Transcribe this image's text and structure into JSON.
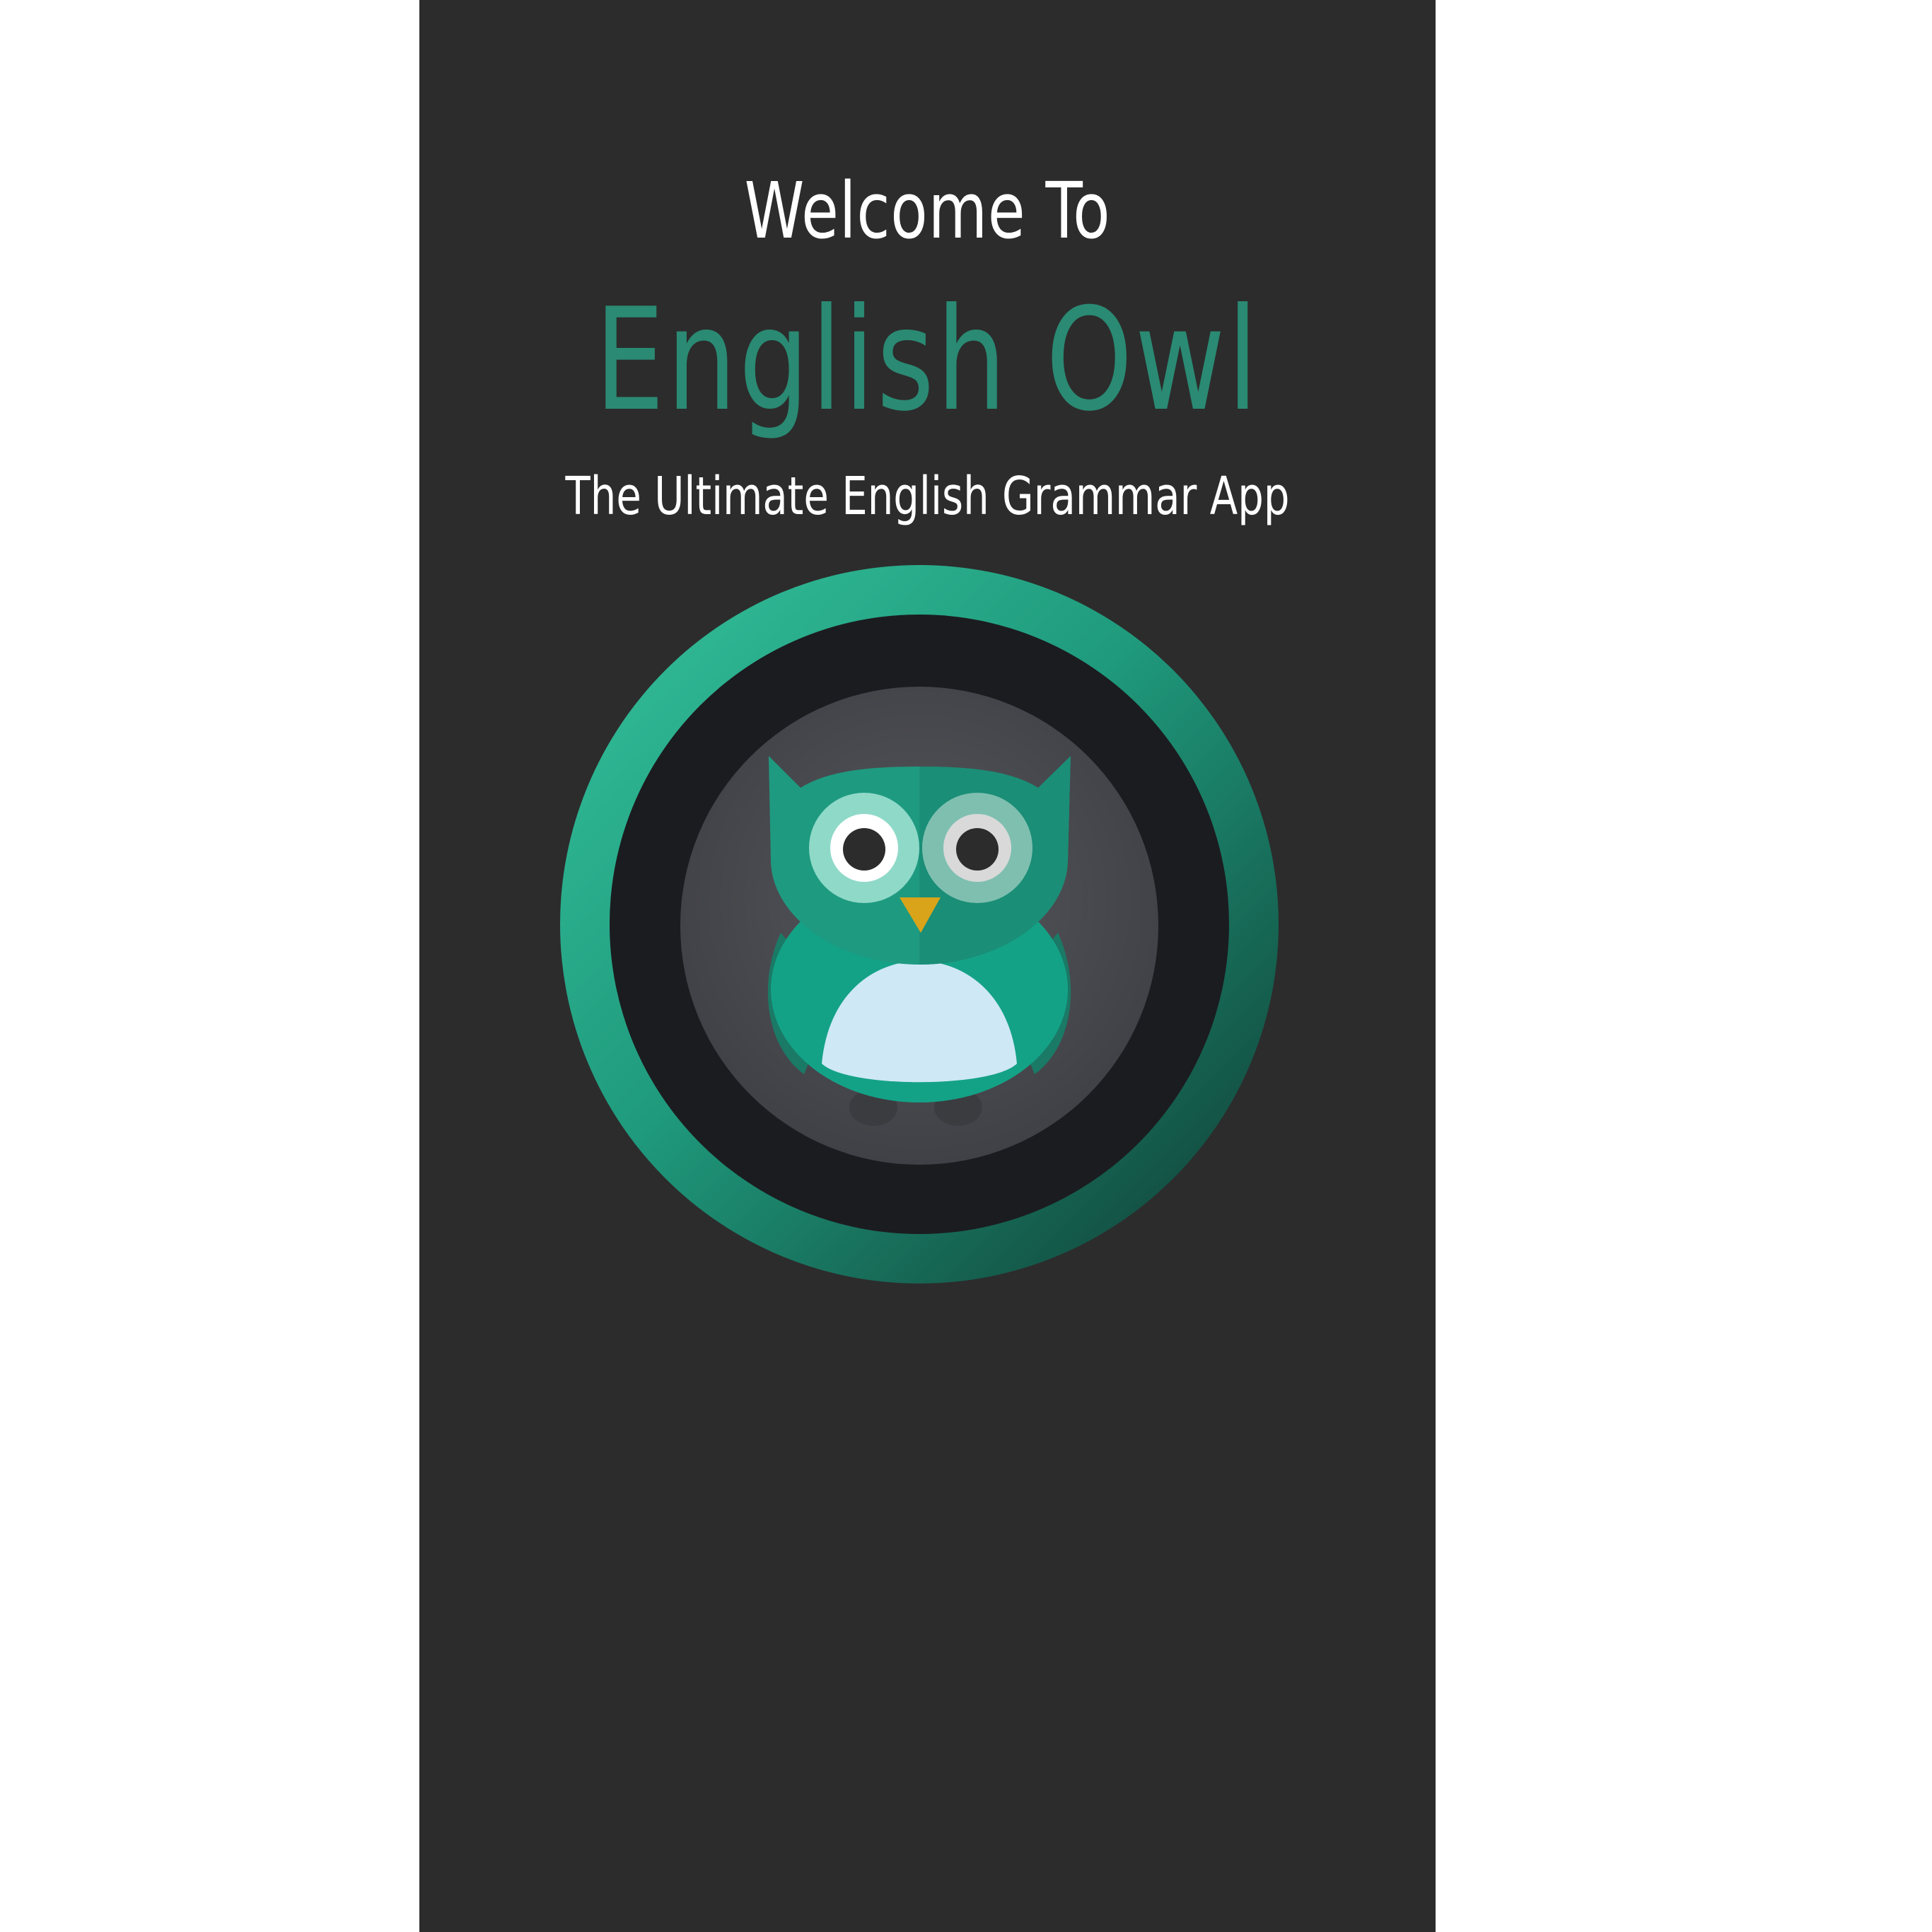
{
  "splash": {
    "welcome_text": "Welcome To",
    "app_name": "English Owl",
    "tagline": "The Ultimate English Grammar App",
    "logo_icon": "owl-logo-icon"
  },
  "colors": {
    "background": "#2c2c2c",
    "page_margin": "#ffffff",
    "accent": "#2a8a73",
    "text": "#ffffff"
  }
}
